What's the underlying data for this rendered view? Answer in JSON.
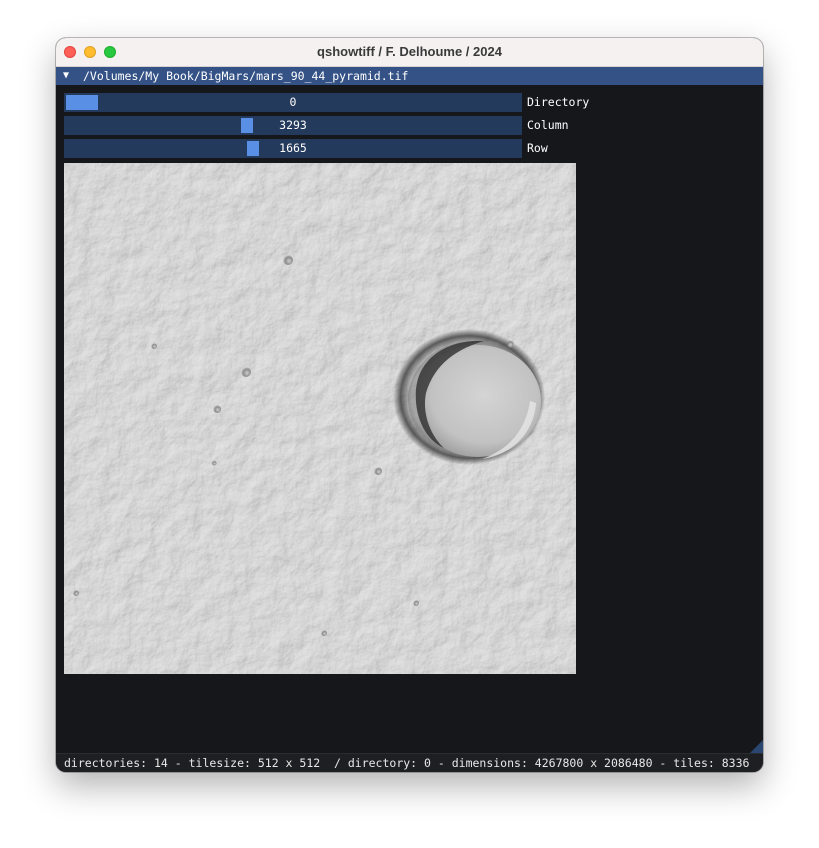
{
  "window": {
    "title": "qshowtiff  / F. Delhoume / 2024"
  },
  "header": {
    "collapse_icon": "triangle-down-icon",
    "path": "/Volumes/My Book/BigMars/mars_90_44_pyramid.tif"
  },
  "sliders": [
    {
      "label": "Directory",
      "value": "0",
      "level": 0.0
    },
    {
      "label": "Column",
      "value": "3293",
      "level": 0.39
    },
    {
      "label": "Row",
      "value": "1665",
      "level": 0.4
    }
  ],
  "status": {
    "text": "directories: 14 - tilesize: 512 x 512  / directory: 0 - dimensions: 4267800 x 2086480 - tiles: 8336"
  },
  "colors": {
    "header_bg": "#345286",
    "slider_track": "#243a5c",
    "slider_grab": "#5a8fe6",
    "window_bg": "#16171a"
  }
}
